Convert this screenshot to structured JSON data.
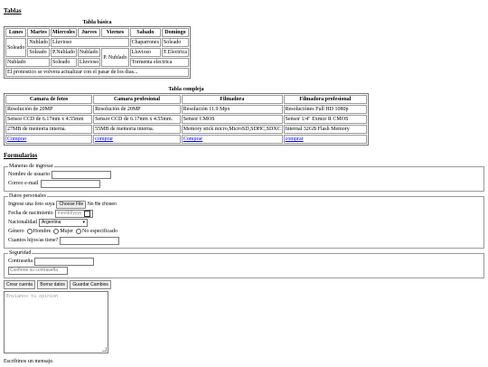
{
  "sections": {
    "tables_title": "Tablas",
    "forms_title": "Formularios"
  },
  "basic_table": {
    "caption": "Tabla básica",
    "headers": [
      "Lunes",
      "Martes",
      "Miercoles",
      "Jueves",
      "Viernes",
      "Sabado",
      "Domingo"
    ],
    "r1": {
      "lunes": "Soleado",
      "martes": "Nublado",
      "miercoles": "Lluvioso",
      "sabado": "Chaparrones",
      "domingo": "Soleado"
    },
    "r2": {
      "martes": "Soleado",
      "miercoles": "P.Nublado",
      "jueves": "Nublado",
      "viernes": "P. Nublado",
      "sabado": "Lluvioso",
      "domingo": "T.Electrica"
    },
    "r3": {
      "lunes": "Nublado",
      "miercoles": "Soleado",
      "jueves": "Lluvioso",
      "sabado_domingo": "Tormenta electrica"
    },
    "footer": "El pronostico se volvera actualizar con el pasar de los dias..."
  },
  "complex_table": {
    "caption": "Tabla compleja",
    "headers": [
      "Camara de fotos",
      "Camara profesional",
      "Filmadora",
      "Filmadora profesional"
    ],
    "rows": [
      [
        "Resolución de 20MP",
        "Resolución de 20MP",
        "Resolución 11.9 Mpx",
        "Resoluciónes Full HD 1080p"
      ],
      [
        "Sensor CCD de 6.17mm x 4.55mm",
        "Sensor CCD de 6.17mm x 4.55mm.",
        "Sensor CMOS",
        "Sensor 1/4\" Exmor R CMOS"
      ],
      [
        "27MB de memoria interna.",
        "55MB de memoria interna.",
        "Memory stick micro,MicroSD,SDHC,SDXC",
        "Internal 32GB Flash Memory"
      ]
    ],
    "links": [
      "Comprar",
      "comprar",
      "Comprar",
      "comprar"
    ]
  },
  "form": {
    "login": {
      "legend": "Maneras de ingresar",
      "user_label": "Nombre de usuario",
      "email_label": "Correo e-mail"
    },
    "personal": {
      "legend": "Datos personales",
      "photo_label": "Ingrese una foto suya",
      "file_button": "Choose File",
      "file_status": "No file chosen",
      "dob_label": "Fecha de nacimiento",
      "dob_placeholder": "mm/dd/yyyy",
      "nationality_label": "Nacionalidad",
      "nationality_value": "Argentina",
      "gender_label": "Género",
      "gender_options": [
        "Hombre",
        "Mujer",
        "No especificado"
      ],
      "children_label": "Cuantos hijos/as tiene?"
    },
    "security": {
      "legend": "Seguridad",
      "password_label": "Contraseña",
      "confirm_placeholder": "Confirme su contraseña"
    },
    "buttons": {
      "create": "Crear cuenta",
      "clear": "Borrar datos",
      "save": "Guardar Cambios"
    },
    "opinion_placeholder": "Envianos tu opinion",
    "message_label": "Escribinos un mensaje."
  }
}
